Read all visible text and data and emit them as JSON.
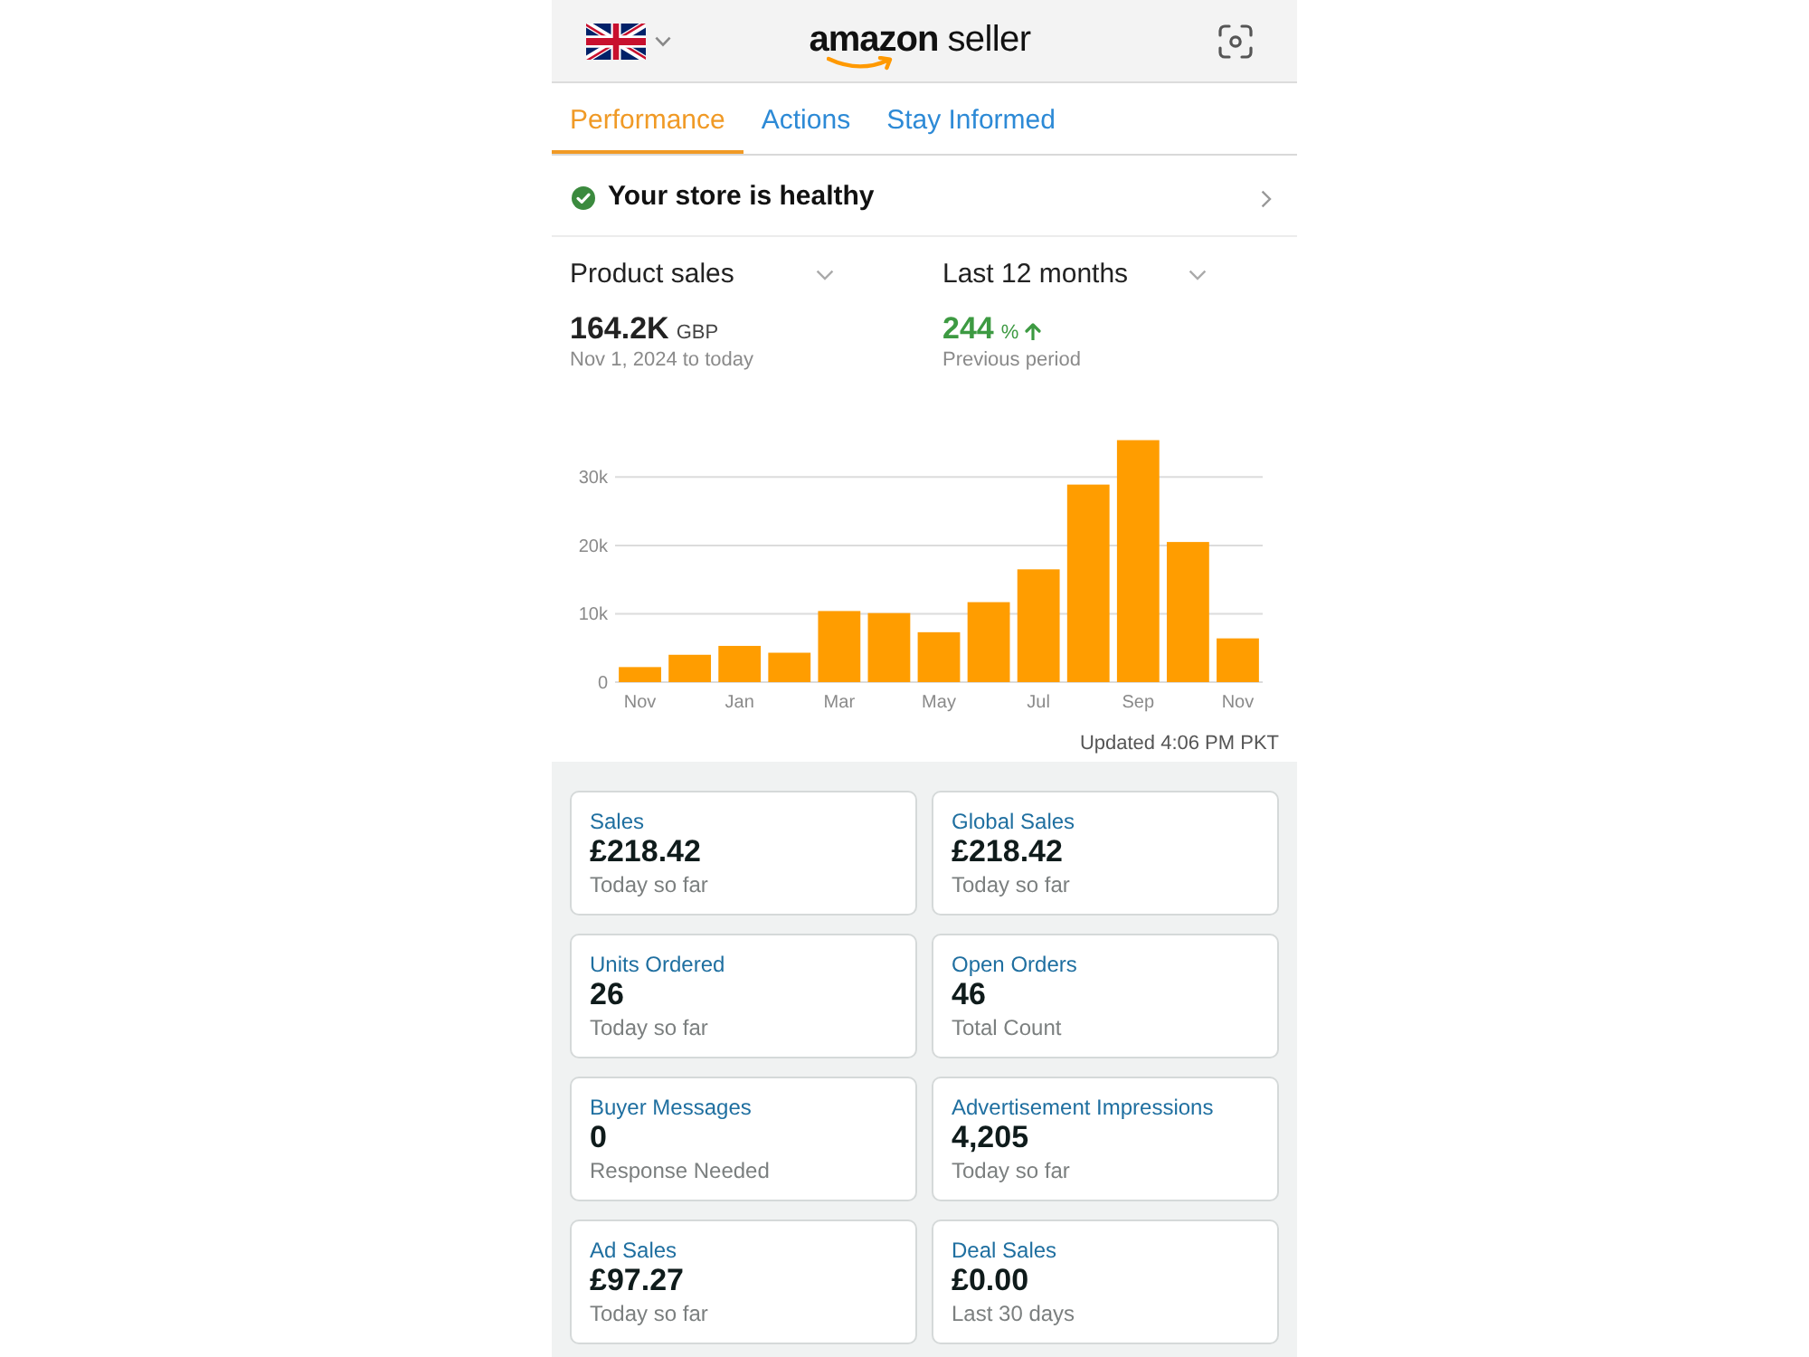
{
  "header": {
    "logo": {
      "brand": "amazon",
      "product": "seller"
    }
  },
  "tabs": [
    {
      "label": "Performance",
      "selected": true
    },
    {
      "label": "Actions",
      "selected": false
    },
    {
      "label": "Stay Informed",
      "selected": false
    }
  ],
  "health": {
    "text": "Your store is healthy"
  },
  "metric_selector": {
    "label": "Product sales",
    "total": "164.2K",
    "currency": "GBP",
    "range": "Nov 1, 2024 to today"
  },
  "period_selector": {
    "label": "Last 12 months",
    "change": "244",
    "unit": "%",
    "rising": true,
    "caption": "Previous period"
  },
  "sales_chart": {
    "chart_data": {
      "type": "bar",
      "categories": [
        "Nov",
        null,
        "Jan",
        null,
        "Mar",
        null,
        "May",
        null,
        "Jul",
        null,
        "Sep",
        null,
        "Nov"
      ],
      "values": [
        2200,
        4000,
        5300,
        4300,
        10400,
        10100,
        7300,
        11700,
        16500,
        28900,
        35400,
        20500,
        6400
      ],
      "ylim": [
        0,
        36000
      ],
      "yticks": [
        0,
        {
          "value": 10000,
          "label": "10k"
        },
        {
          "value": 20000,
          "label": "20k"
        },
        {
          "value": 30000,
          "label": "30k"
        }
      ],
      "grid": true
    },
    "updated": "Updated 4:06 PM PKT"
  },
  "cards": [
    {
      "title": "Sales",
      "value": "£218.42",
      "caption": "Today so far"
    },
    {
      "title": "Global Sales",
      "value": "£218.42",
      "caption": "Today so far"
    },
    {
      "title": "Units Ordered",
      "value": "26",
      "caption": "Today so far"
    },
    {
      "title": "Open Orders",
      "value": "46",
      "caption": "Total Count"
    },
    {
      "title": "Buyer Messages",
      "value": "0",
      "caption": "Response Needed"
    },
    {
      "title": "Advertisement Impressions",
      "value": "4,205",
      "caption": "Today so far"
    },
    {
      "title": "Ad Sales",
      "value": "£97.27",
      "caption": "Today so far"
    },
    {
      "title": "Deal Sales",
      "value": "£0.00",
      "caption": "Last 30 days"
    }
  ]
}
